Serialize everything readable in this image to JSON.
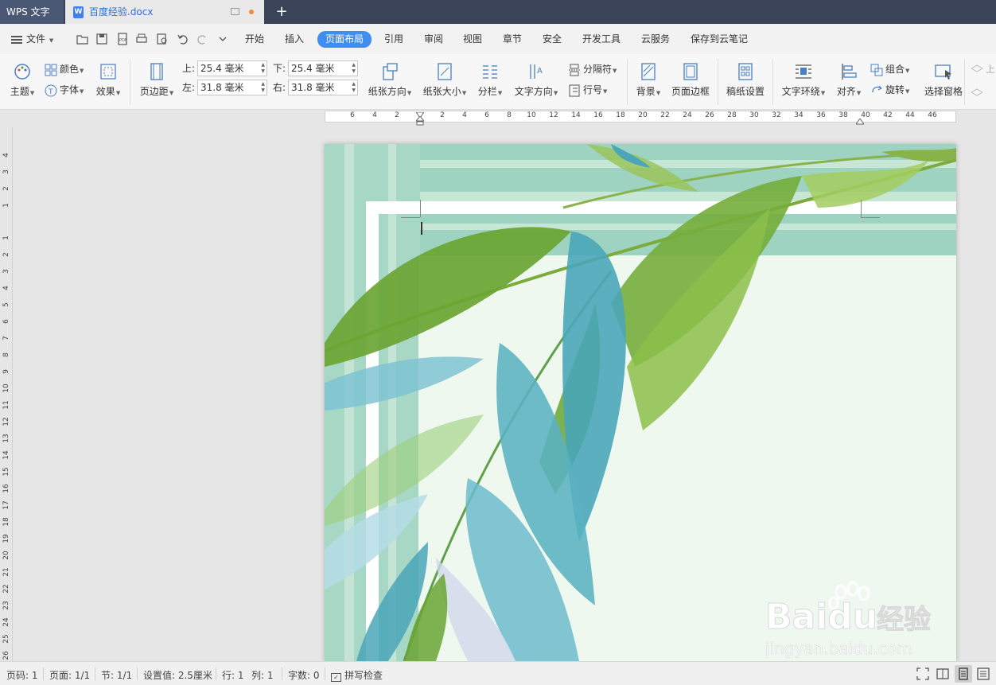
{
  "titlebar": {
    "app_name": "WPS 文字",
    "doc_name": "百度经验.docx"
  },
  "menubar": {
    "file_label": "文件",
    "tabs": [
      "开始",
      "插入",
      "页面布局",
      "引用",
      "审阅",
      "视图",
      "章节",
      "安全",
      "开发工具",
      "云服务",
      "保存到云笔记"
    ],
    "active_tab": "页面布局"
  },
  "ribbon": {
    "theme": "主题",
    "color": "颜色",
    "font": "字体",
    "effect": "效果",
    "margins": "页边距",
    "top_label": "上:",
    "top_value": "25.4 毫米",
    "bottom_label": "下:",
    "bottom_value": "25.4 毫米",
    "left_label": "左:",
    "left_value": "31.8 毫米",
    "right_label": "右:",
    "right_value": "31.8 毫米",
    "orientation": "纸张方向",
    "size": "纸张大小",
    "columns": "分栏",
    "text_direction": "文字方向",
    "breaks": "分隔符",
    "line_numbers": "行号",
    "background": "背景",
    "page_border": "页面边框",
    "manuscript": "稿纸设置",
    "text_wrap": "文字环绕",
    "align": "对齐",
    "group": "组合",
    "rotate": "旋转",
    "selection_pane": "选择窗格",
    "bring_forward": "上"
  },
  "ruler": {
    "h_ticks": [
      "6",
      "4",
      "2",
      "2",
      "4",
      "6",
      "8",
      "10",
      "12",
      "14",
      "16",
      "18",
      "20",
      "22",
      "24",
      "26",
      "28",
      "30",
      "32",
      "34",
      "36",
      "38",
      "40",
      "42",
      "44",
      "46"
    ],
    "v_ticks": [
      "4",
      "3",
      "2",
      "1",
      "1",
      "2",
      "3",
      "4",
      "5",
      "6",
      "7",
      "8",
      "9",
      "10",
      "11",
      "12",
      "13",
      "14",
      "15",
      "16",
      "17",
      "18",
      "19",
      "20",
      "21",
      "22",
      "23",
      "24",
      "25",
      "26"
    ]
  },
  "statusbar": {
    "page_no": "页码: 1",
    "pages": "页面: 1/1",
    "section": "节: 1/1",
    "setting": "设置值: 2.5厘米",
    "row": "行: 1",
    "col": "列: 1",
    "word_count": "字数: 0",
    "spell_check": "拼写检查"
  },
  "watermark": {
    "brand": "Baidu",
    "brand_cn": "经验",
    "url": "jingyan.baidu.com"
  },
  "colors": {
    "titlebar": "#3b4358",
    "accent": "#3c8ff0",
    "page_bg": "#f1faf3",
    "leaf_green": "#6aa533",
    "leaf_teal": "#4aa6b8"
  }
}
